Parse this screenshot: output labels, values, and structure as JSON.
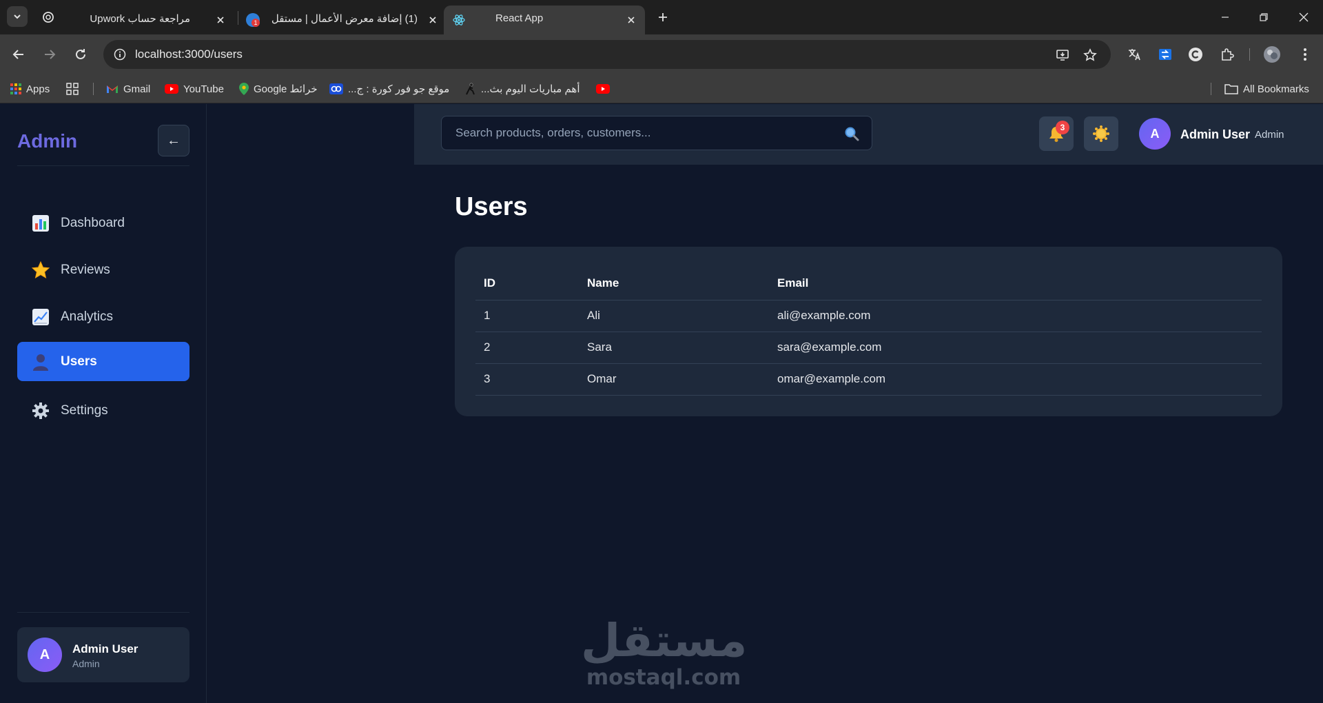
{
  "browser": {
    "tabs": [
      {
        "title": "مراجعة حساب Upwork"
      },
      {
        "title": "(1) إضافة معرض الأعمال | مستقل",
        "badge": "1"
      },
      {
        "title": "React App"
      }
    ],
    "url": "localhost:3000/users",
    "bookmarks": {
      "apps": "Apps",
      "gmail": "Gmail",
      "youtube": "YouTube",
      "maps": "Google خرائط",
      "koora": "موقع جو فور كورة : ج...",
      "matches": "أهم مباريات اليوم بث...",
      "all": "All Bookmarks"
    }
  },
  "sidebar": {
    "brand": "Admin",
    "collapse_label": "←",
    "items": [
      {
        "label": "Dashboard",
        "icon": "bar-chart-icon"
      },
      {
        "label": "Reviews",
        "icon": "star-icon"
      },
      {
        "label": "Analytics",
        "icon": "trend-chart-icon"
      },
      {
        "label": "Users",
        "icon": "user-icon",
        "active": true
      },
      {
        "label": "Settings",
        "icon": "gear-icon"
      }
    ],
    "user": {
      "initial": "A",
      "name": "Admin User",
      "role": "Admin"
    }
  },
  "topbar": {
    "search_placeholder": "Search products, orders, customers...",
    "notifications_count": "3",
    "user": {
      "initial": "A",
      "name": "Admin User",
      "role": "Admin"
    }
  },
  "main": {
    "title": "Users",
    "table": {
      "columns": [
        "ID",
        "Name",
        "Email"
      ],
      "rows": [
        [
          "1",
          "Ali",
          "ali@example.com"
        ],
        [
          "2",
          "Sara",
          "sara@example.com"
        ],
        [
          "3",
          "Omar",
          "omar@example.com"
        ]
      ]
    }
  },
  "watermark": {
    "arabic": "مستقل",
    "latin": "mostaql.com"
  },
  "colors": {
    "background": "#0f172a",
    "panel": "#1e293b",
    "accent": "#2563eb",
    "brand": "#6d6ae0",
    "badge": "#ef4444"
  }
}
